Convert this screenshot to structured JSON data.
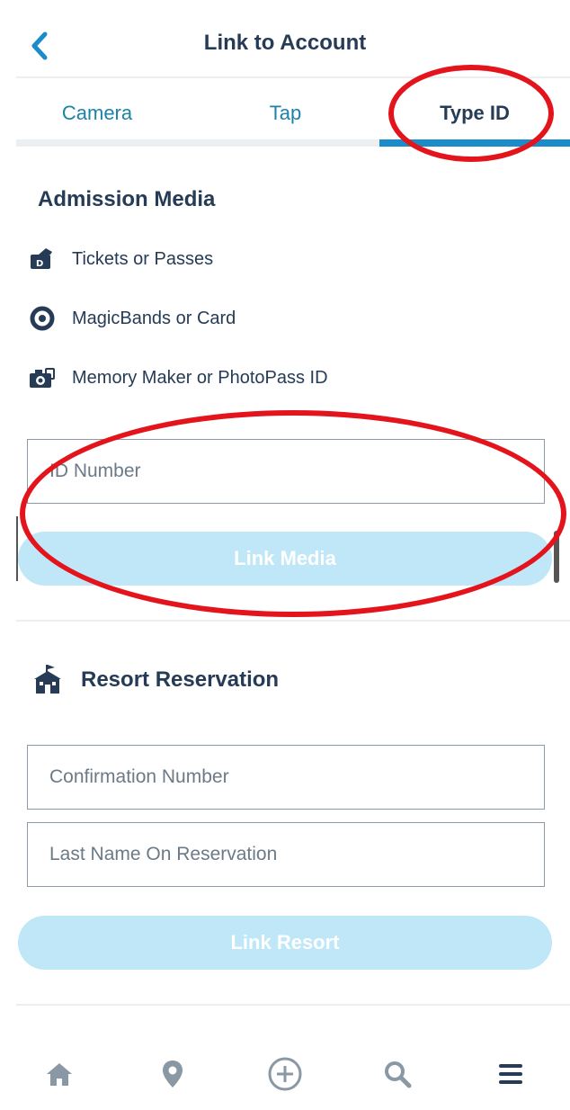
{
  "header": {
    "title": "Link to Account"
  },
  "tabs": [
    {
      "label": "Camera"
    },
    {
      "label": "Tap"
    },
    {
      "label": "Type ID"
    }
  ],
  "admission": {
    "title": "Admission Media",
    "items": [
      {
        "label": "Tickets or Passes",
        "icon": "ticket-icon"
      },
      {
        "label": "MagicBands or Card",
        "icon": "magicband-icon"
      },
      {
        "label": "Memory Maker or PhotoPass ID",
        "icon": "photopass-camera-icon"
      }
    ],
    "id_placeholder": "ID Number",
    "link_button": "Link Media"
  },
  "resort": {
    "title": "Resort Reservation",
    "confirmation_placeholder": "Confirmation Number",
    "last_name_placeholder": "Last Name On Reservation",
    "link_button": "Link Resort"
  },
  "bottom_nav": [
    {
      "icon": "home-icon"
    },
    {
      "icon": "map-pin-icon"
    },
    {
      "icon": "plus-circle-icon"
    },
    {
      "icon": "search-icon"
    },
    {
      "icon": "menu-icon"
    }
  ],
  "colors": {
    "accent": "#1b8cc9",
    "tab_text": "#1c83a8",
    "heading": "#253b56",
    "button_disabled": "#bfe7f8",
    "annotation": "#e3141c"
  }
}
